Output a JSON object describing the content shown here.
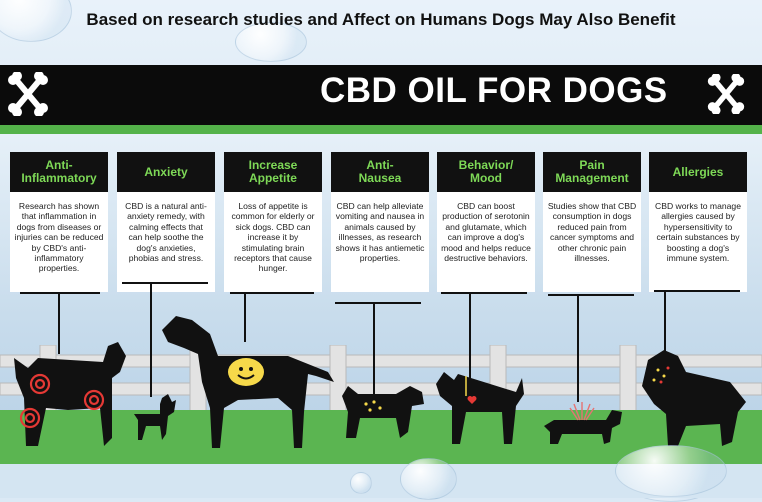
{
  "caption": "Based on research studies and Affect on Humans Dogs May Also Benefit",
  "banner": {
    "title": "CBD OIL FOR DOGS"
  },
  "colors": {
    "heading_text": "#7ed957",
    "banner": "#0b0b0b",
    "accent_green": "#54b34a"
  },
  "benefits": [
    {
      "title": "Anti-\nInflammatory",
      "text": "Research has shown that inflammation in dogs from diseases or injuries can be reduced by CBD's anti-inflammatory properties."
    },
    {
      "title": "Anxiety",
      "text": "CBD is a natural anti-anxiety remedy, with calming effects that can help soothe the dog's anxieties, phobias and stress."
    },
    {
      "title": "Increase\nAppetite",
      "text": "Loss of appetite is common for elderly or sick dogs. CBD can increase it by stimulating brain receptors that cause hunger."
    },
    {
      "title": "Anti-\nNausea",
      "text": "CBD can help alleviate vomiting and nausea in animals caused by illnesses, as research shows it has antiemetic properties."
    },
    {
      "title": "Behavior/\nMood",
      "text": "CBD can boost production of serotonin and glutamate, which can improve a dog's mood and helps reduce destructive behaviors."
    },
    {
      "title": "Pain\nManagement",
      "text": "Studies show that CBD consumption in dogs reduced pain from cancer symptoms and other chronic pain illnesses."
    },
    {
      "title": "Allergies",
      "text": "CBD works to manage allergies caused by hypersensitivity to certain substances by boosting a dog's immune system."
    }
  ]
}
